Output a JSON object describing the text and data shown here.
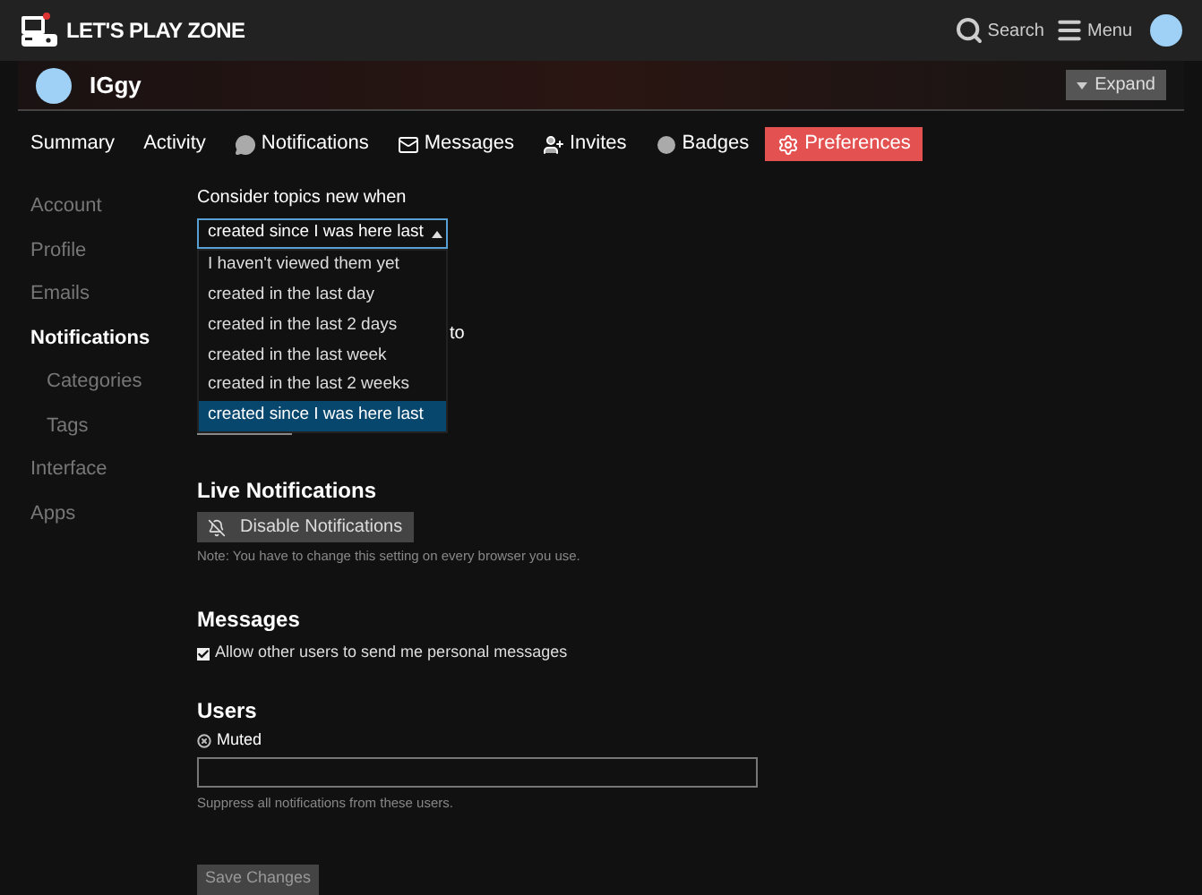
{
  "header": {
    "site_name": "LET'S PLAY ZONE",
    "actions": [
      {
        "kind": "search",
        "label": "Search"
      },
      {
        "kind": "menu",
        "label": "Menu"
      }
    ]
  },
  "profile": {
    "username": "IGgy",
    "expand_label": "Expand"
  },
  "tabs": [
    {
      "label": "Summary",
      "kind": "plain",
      "selected": false
    },
    {
      "label": "Activity",
      "kind": "plain",
      "selected": false
    },
    {
      "label": "Notifications",
      "kind": "chat",
      "selected": false
    },
    {
      "label": "Messages",
      "kind": "mail",
      "selected": false
    },
    {
      "label": "Invites",
      "kind": "invite",
      "selected": false
    },
    {
      "label": "Badges",
      "kind": "badge",
      "selected": false
    },
    {
      "label": "Preferences",
      "kind": "settings",
      "selected": true
    }
  ],
  "sidebar": {
    "items": [
      {
        "label": "Account",
        "selected": false
      },
      {
        "label": "Profile",
        "selected": false
      },
      {
        "label": "Emails",
        "selected": false
      },
      {
        "label": "Notifications",
        "selected": true,
        "children": [
          {
            "label": "Categories",
            "selected": false
          },
          {
            "label": "Tags",
            "selected": false
          }
        ]
      },
      {
        "label": "Interface",
        "selected": false
      },
      {
        "label": "Apps",
        "selected": false
      }
    ]
  },
  "topics_new": {
    "label": "Consider topics new when",
    "value": "created since I was here last",
    "expanded": true,
    "options": [
      {
        "label": "I haven't viewed them yet",
        "selected": false
      },
      {
        "label": "created in the last day",
        "selected": false
      },
      {
        "label": "created in the last 2 days",
        "selected": false
      },
      {
        "label": "created in the last week",
        "selected": false
      },
      {
        "label": "created in the last 2 weeks",
        "selected": false
      },
      {
        "label": "created since I was here last",
        "selected": true
      }
    ]
  },
  "covered_fragment": "to",
  "live_notifications": {
    "title": "Live Notifications",
    "button": "Disable Notifications",
    "note": "Note: You have to change this setting on every browser you use."
  },
  "messages": {
    "title": "Messages",
    "allow_pm": {
      "label": "Allow other users to send me personal messages",
      "checked": true
    }
  },
  "users": {
    "title": "Users",
    "muted_label": "Muted",
    "hint": "Suppress all notifications from these users."
  },
  "save_button": "Save Changes"
}
